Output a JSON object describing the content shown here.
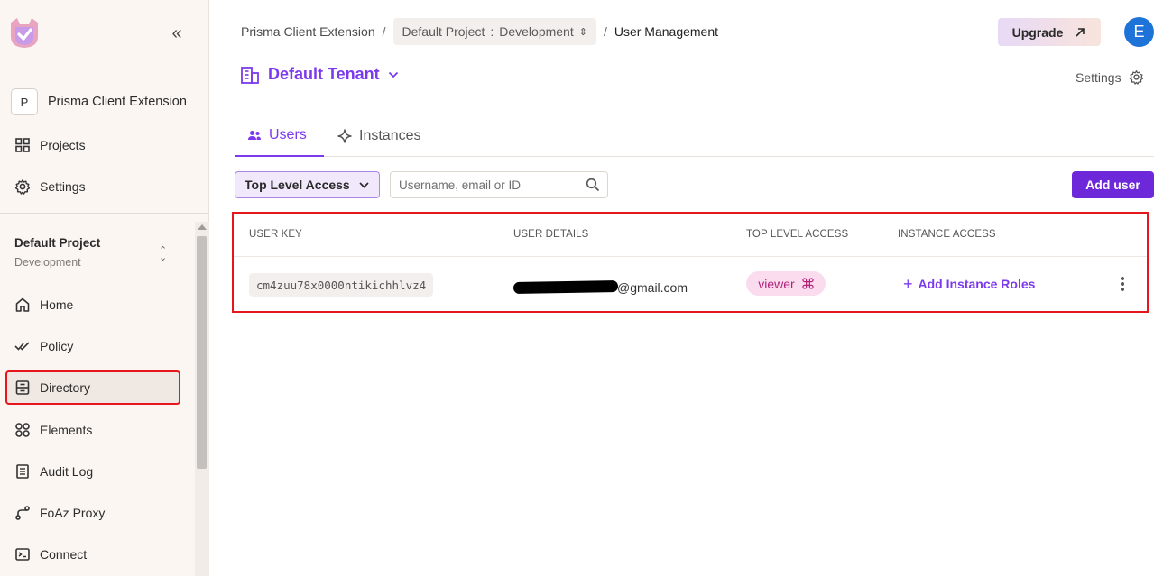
{
  "sidebar": {
    "org_badge": "P",
    "org_name": "Prisma Client Extension",
    "top_items": [
      {
        "label": "Projects",
        "icon": "grid-icon"
      },
      {
        "label": "Settings",
        "icon": "gear-icon"
      }
    ],
    "project": {
      "name": "Default Project",
      "env": "Development"
    },
    "items": [
      {
        "label": "Home",
        "icon": "home-icon"
      },
      {
        "label": "Policy",
        "icon": "check-check-icon"
      },
      {
        "label": "Directory",
        "icon": "directory-icon",
        "active": true
      },
      {
        "label": "Elements",
        "icon": "elements-icon"
      },
      {
        "label": "Audit Log",
        "icon": "list-icon"
      },
      {
        "label": "FoAz Proxy",
        "icon": "proxy-icon"
      },
      {
        "label": "Connect",
        "icon": "terminal-icon"
      }
    ]
  },
  "breadcrumb": {
    "org": "Prisma Client Extension",
    "project": "Default Project",
    "env": "Development",
    "page": "User Management"
  },
  "header": {
    "upgrade_label": "Upgrade",
    "avatar_initial": "E",
    "tenant": "Default Tenant",
    "settings_label": "Settings"
  },
  "tabs": {
    "users": "Users",
    "instances": "Instances"
  },
  "toolbar": {
    "filter_label": "Top Level Access",
    "search_placeholder": "Username, email or ID",
    "add_user_label": "Add user"
  },
  "table": {
    "columns": [
      "USER KEY",
      "USER DETAILS",
      "TOP LEVEL ACCESS",
      "INSTANCE ACCESS"
    ],
    "rows": [
      {
        "user_key": "cm4zuu78x0000ntikichhlvz4",
        "email_suffix": "@gmail.com",
        "role": "viewer",
        "instance_action": "Add Instance Roles"
      }
    ]
  },
  "colors": {
    "accent": "#7c3aed",
    "primary_button": "#6d28d9",
    "highlight": "#e5161c",
    "avatar": "#1e73d8"
  }
}
